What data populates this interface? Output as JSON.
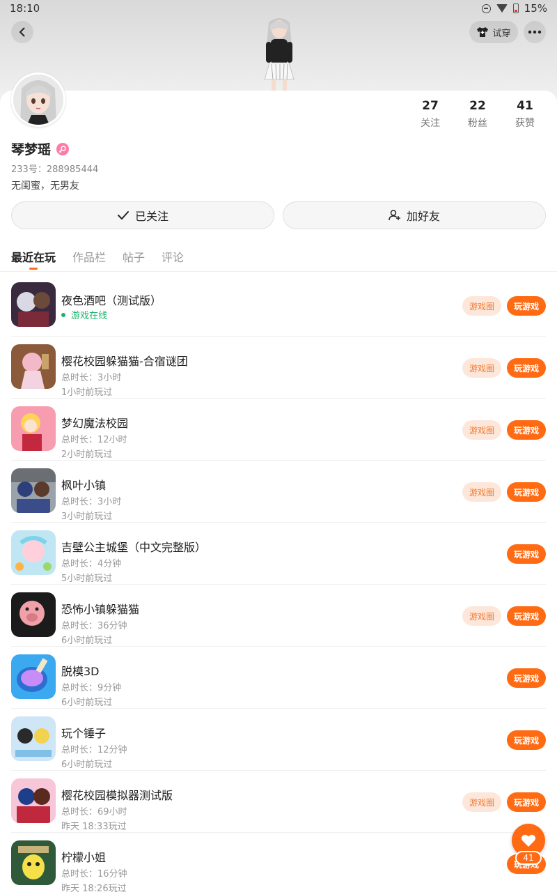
{
  "status_bar": {
    "time": "18:10",
    "battery": "15%"
  },
  "header": {
    "try_on_label": "试穿"
  },
  "profile": {
    "username": "琴梦瑶",
    "user_id": "233号：288985444",
    "bio": "无闺蜜，无男友",
    "stats": [
      {
        "value": "27",
        "label": "关注"
      },
      {
        "value": "22",
        "label": "粉丝"
      },
      {
        "value": "41",
        "label": "获赞"
      }
    ],
    "follow_label": "已关注",
    "add_friend_label": "加好友"
  },
  "tabs": [
    "最近在玩",
    "作品栏",
    "帖子",
    "评论"
  ],
  "buttons": {
    "circle": "游戏圈",
    "play": "玩游戏"
  },
  "games": [
    {
      "name": "夜色酒吧（测试版）",
      "online": "游戏在线",
      "has_circle": true
    },
    {
      "name": "樱花校园躲猫猫-合宿谜团",
      "duration": "总时长：3小时",
      "last_played": "1小时前玩过",
      "has_circle": true
    },
    {
      "name": "梦幻魔法校园",
      "duration": "总时长：12小时",
      "last_played": "2小时前玩过",
      "has_circle": true
    },
    {
      "name": "枫叶小镇",
      "duration": "总时长：3小时",
      "last_played": "3小时前玩过",
      "has_circle": true
    },
    {
      "name": "吉壁公主城堡（中文完整版）",
      "duration": "总时长：4分钟",
      "last_played": "5小时前玩过",
      "has_circle": false
    },
    {
      "name": "恐怖小镇躲猫猫",
      "duration": "总时长：36分钟",
      "last_played": "6小时前玩过",
      "has_circle": true
    },
    {
      "name": "脱模3D",
      "duration": "总时长：9分钟",
      "last_played": "6小时前玩过",
      "has_circle": false
    },
    {
      "name": "玩个锤子",
      "duration": "总时长：12分钟",
      "last_played": "6小时前玩过",
      "has_circle": false
    },
    {
      "name": "樱花校园模拟器测试版",
      "duration": "总时长：69小时",
      "last_played": "昨天 18:33玩过",
      "has_circle": true
    },
    {
      "name": "柠檬小姐",
      "duration": "总时长：16分钟",
      "last_played": "昨天 18:26玩过",
      "has_circle": false
    }
  ],
  "like_fab": {
    "count": "41"
  },
  "colors": {
    "accent": "#ff6a13",
    "online": "#19b36b",
    "circle_bg": "#fde7da"
  }
}
